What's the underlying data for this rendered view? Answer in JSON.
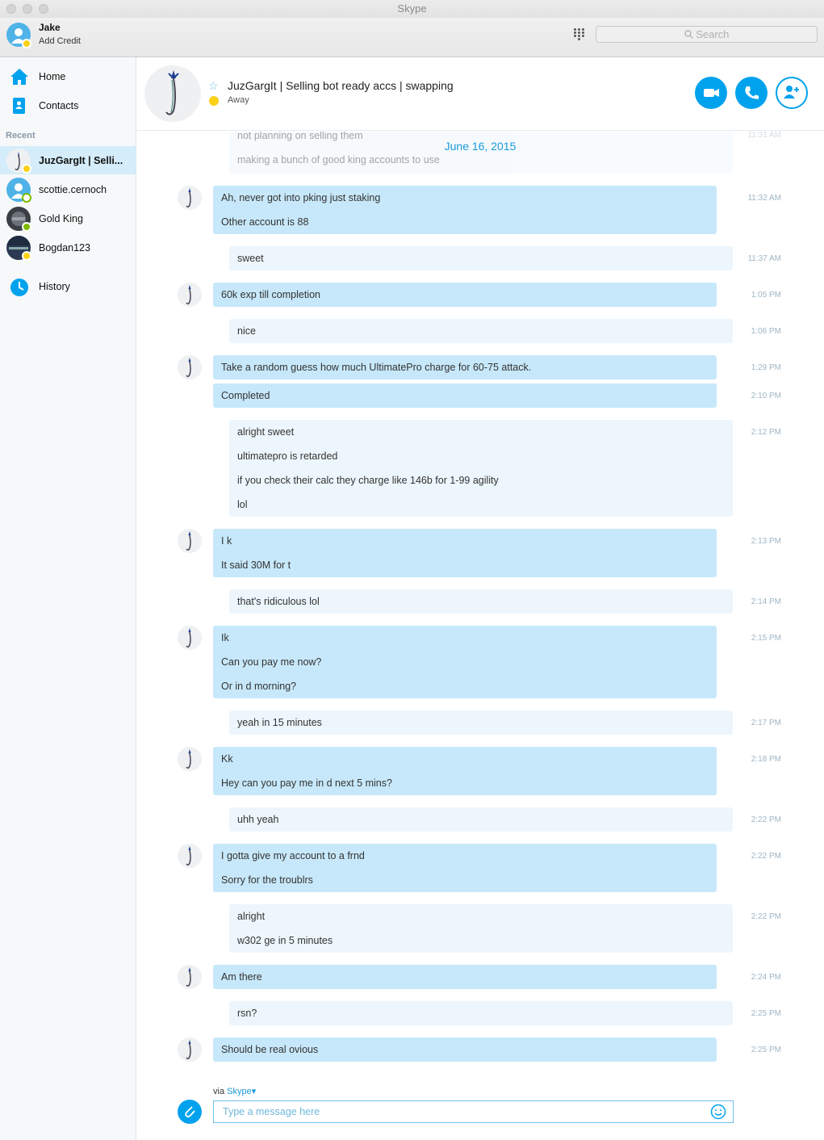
{
  "window": {
    "title": "Skype"
  },
  "profile": {
    "name": "Jake",
    "credit_label": "Add Credit"
  },
  "search": {
    "placeholder": "Search"
  },
  "nav": [
    {
      "label": "Home",
      "icon": "home-icon"
    },
    {
      "label": "Contacts",
      "icon": "contacts-icon"
    }
  ],
  "recent_header": "Recent",
  "recent": [
    {
      "label": "JuzGargIt | Selli...",
      "status": "away",
      "active": true
    },
    {
      "label": "scottie.cernoch",
      "status": "offline",
      "active": false
    },
    {
      "label": "Gold King",
      "status": "online",
      "active": false
    },
    {
      "label": "Bogdan123",
      "status": "away",
      "active": false
    }
  ],
  "history_label": "History",
  "conversation": {
    "title": "JuzGargIt | Selling bot ready accs | swapping",
    "status": "Away",
    "date": "June 16, 2015",
    "partial_top": [
      "not planning on selling them",
      "making a bunch of good king accounts to use"
    ],
    "partial_top_time": "11:31 AM",
    "messages": [
      {
        "from": "them",
        "time": "11:32 AM",
        "lines": [
          "Ah, never got into pking just staking",
          "Other account is 88"
        ]
      },
      {
        "from": "me",
        "time": "11:37 AM",
        "lines": [
          "sweet"
        ]
      },
      {
        "from": "them",
        "time": "1:05 PM",
        "lines": [
          "60k exp till completion"
        ]
      },
      {
        "from": "me",
        "time": "1:06 PM",
        "lines": [
          "nice"
        ]
      },
      {
        "from": "them",
        "time": "1:29 PM",
        "lines": [
          "Take a random guess how much UltimatePro charge for 60-75 attack."
        ]
      },
      {
        "from": "them",
        "time": "2:10 PM",
        "lines": [
          "Completed"
        ],
        "no_avatar": true
      },
      {
        "from": "me",
        "time": "2:12 PM",
        "lines": [
          "alright sweet",
          "ultimatepro is retarded",
          "if you check their calc they charge like 146b for 1-99 agility",
          "lol"
        ]
      },
      {
        "from": "them",
        "time": "2:13 PM",
        "lines": [
          "I k",
          "It said 30M for t"
        ]
      },
      {
        "from": "me",
        "time": "2:14 PM",
        "lines": [
          "that's ridiculous lol"
        ]
      },
      {
        "from": "them",
        "time": "2:15 PM",
        "lines": [
          "Ik",
          "Can you pay me now?",
          "Or in d morning?"
        ]
      },
      {
        "from": "me",
        "time": "2:17 PM",
        "lines": [
          "yeah in 15 minutes"
        ]
      },
      {
        "from": "them",
        "time": "2:18 PM",
        "lines": [
          "Kk",
          "Hey can you pay me in d next 5 mins?"
        ]
      },
      {
        "from": "me",
        "time": "2:22 PM",
        "lines": [
          "uhh yeah"
        ]
      },
      {
        "from": "them",
        "time": "2:22 PM",
        "lines": [
          "I gotta give my account to a frnd",
          "Sorry for the troublrs"
        ]
      },
      {
        "from": "me",
        "time": "2:22 PM",
        "lines": [
          "alright",
          "w302 ge in 5 minutes"
        ]
      },
      {
        "from": "them",
        "time": "2:24 PM",
        "lines": [
          "Am there"
        ]
      },
      {
        "from": "me",
        "time": "2:25 PM",
        "lines": [
          "rsn?"
        ]
      },
      {
        "from": "them",
        "time": "2:25 PM",
        "lines": [
          "Should be real ovious"
        ]
      }
    ]
  },
  "compose": {
    "via_prefix": "via",
    "via_service": "Skype",
    "placeholder": "Type a message here"
  },
  "colors": {
    "accent": "#00a2ed",
    "them_bubble": "#c7e8fa",
    "me_bubble": "#edf6fc",
    "away": "#fcd116",
    "online": "#7fba00"
  }
}
